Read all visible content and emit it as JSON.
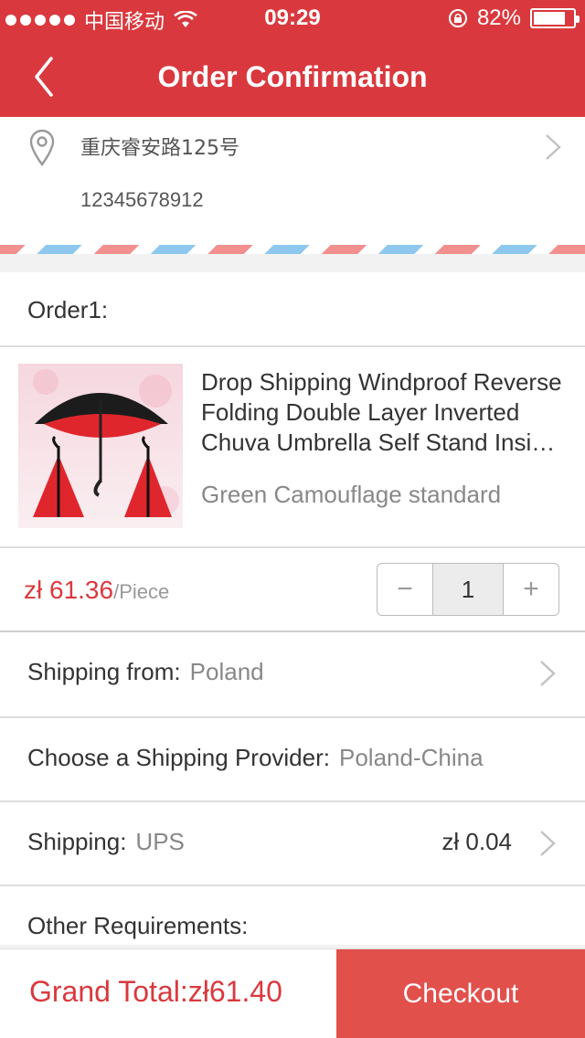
{
  "status_bar": {
    "carrier": "中国移动",
    "time": "09:29",
    "battery_percent": "82%",
    "battery_level": 0.82
  },
  "nav": {
    "title": "Order Confirmation",
    "back_icon": "chevron-left-icon"
  },
  "address": {
    "street": "重庆睿安路125号",
    "phone": "12345678912",
    "icon": "location-pin-icon"
  },
  "order": {
    "label": "Order1:",
    "product": {
      "name": "Drop Shipping Windproof Reverse Folding Double Layer Inverted Chuva Umbrella Self Stand Inside Out Rain Protection C-Hook Hands For Car",
      "variant": "Green Camouflage standard",
      "price": "zł 61.36",
      "unit": "/Piece",
      "quantity": "1",
      "minus": "−",
      "plus": "+"
    },
    "shipping_from": {
      "label": "Shipping from:",
      "value": "Poland"
    },
    "provider": {
      "label": "Choose a Shipping Provider:",
      "value": "Poland-China"
    },
    "shipping": {
      "label": "Shipping:",
      "value": "UPS",
      "cost": "zł 0.04"
    },
    "other_requirements": {
      "label": "Other Requirements:"
    }
  },
  "footer": {
    "grand_total": "Grand Total:zł61.40",
    "checkout": "Checkout"
  },
  "colors": {
    "accent": "#d9393e",
    "checkout_bg": "#e2504c"
  }
}
